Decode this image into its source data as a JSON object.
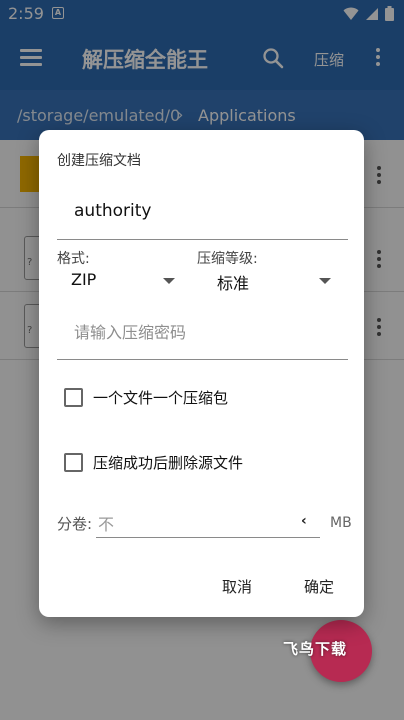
{
  "status_bar": {
    "time": "2:59",
    "notification_letter": "A"
  },
  "app_bar": {
    "title": "解压缩全能王",
    "compress_label": "压缩"
  },
  "breadcrumb": {
    "root": "/storage/emulated/0",
    "separator": "›",
    "current": "Applications"
  },
  "dialog": {
    "title": "创建压缩文档",
    "filename_value": "authority",
    "format_label": "格式:",
    "format_value": "ZIP",
    "level_label": "压缩等级:",
    "level_value": "标准",
    "password_placeholder": "请输入压缩密码",
    "option_one_per_file": "一个文件一个压缩包",
    "option_delete_source": "压缩成功后删除源文件",
    "split_label": "分卷:",
    "split_value": "不",
    "split_caret": "‹",
    "split_unit": "MB",
    "cancel_label": "取消",
    "confirm_label": "确定"
  },
  "watermark": "飞鸟下载",
  "colors": {
    "primary": "#2e6bb1",
    "fab": "#b72a52"
  }
}
